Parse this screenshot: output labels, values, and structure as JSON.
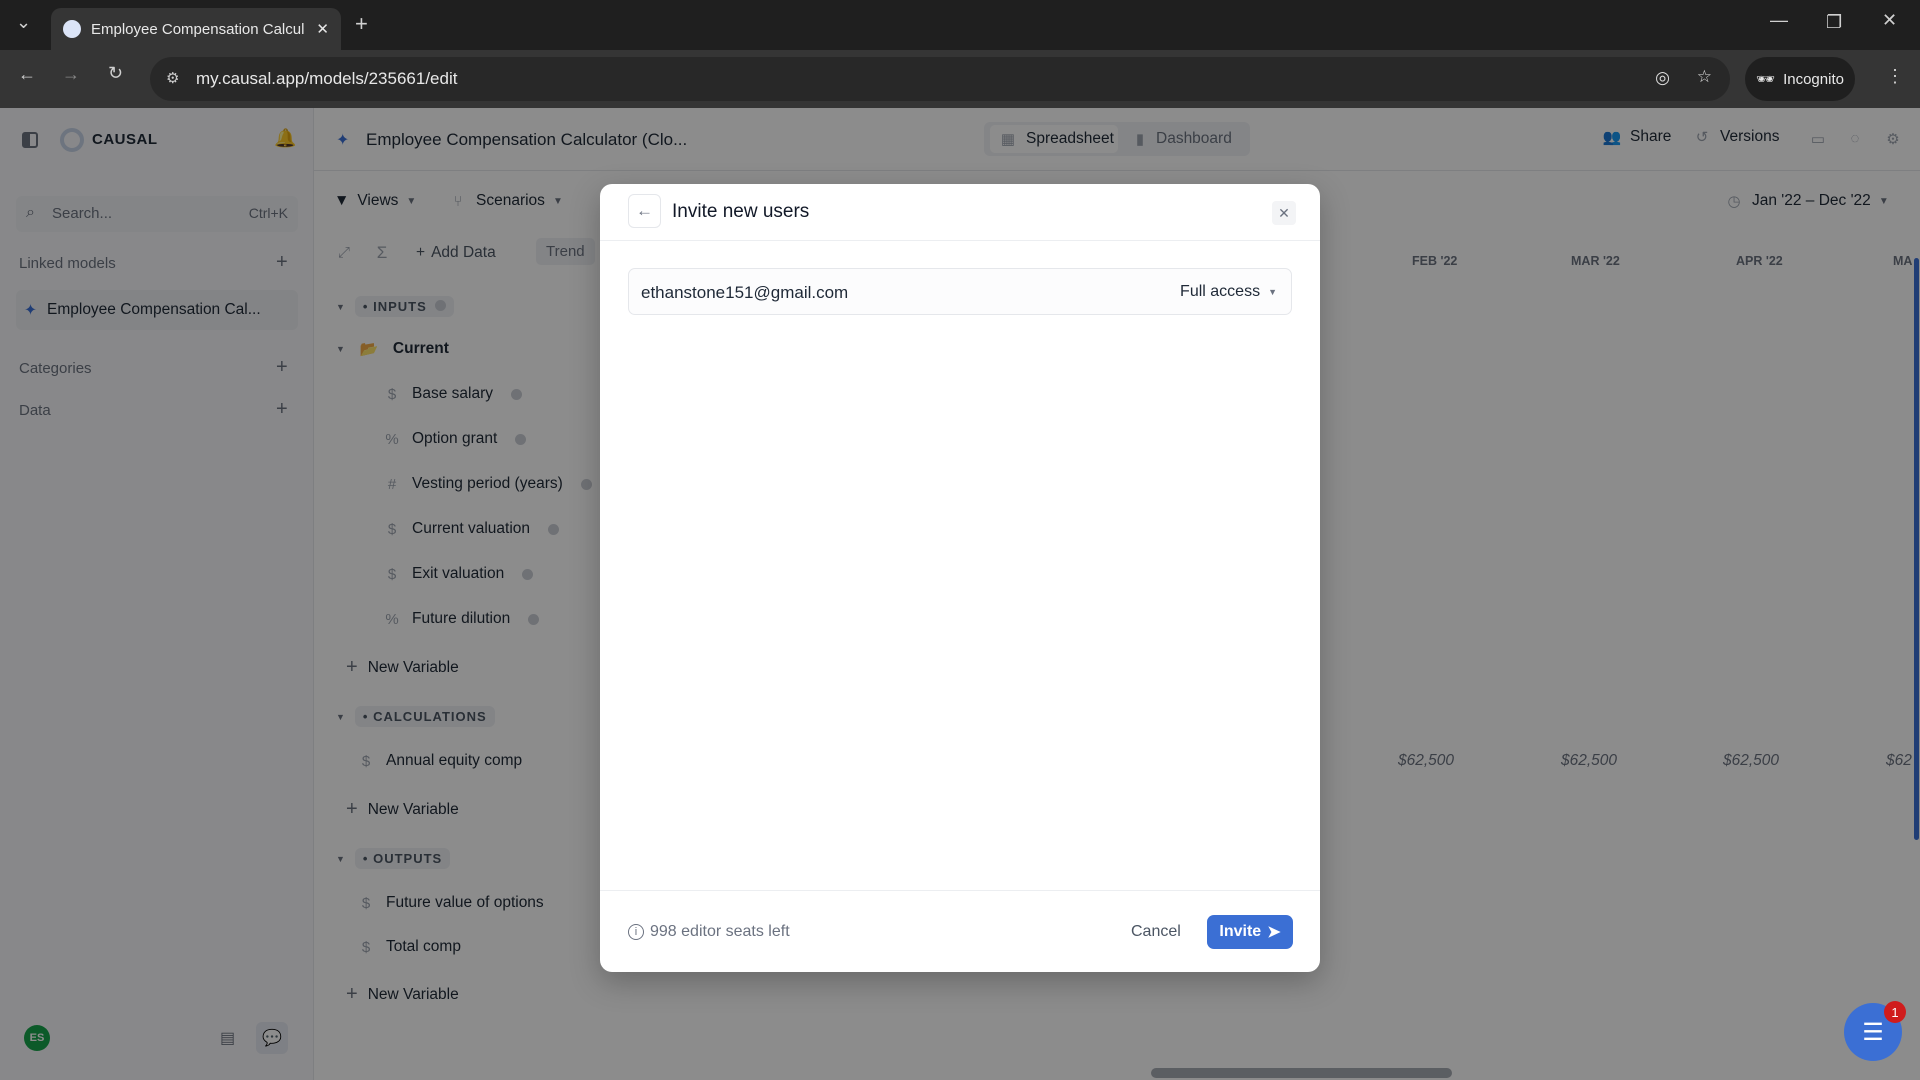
{
  "browser": {
    "tab_title": "Employee Compensation Calcul",
    "url": "my.causal.app/models/235661/edit",
    "incognito_label": "Incognito"
  },
  "sidebar": {
    "brand": "CAUSAL",
    "search_placeholder": "Search...",
    "search_shortcut": "Ctrl+K",
    "linked_models_label": "Linked models",
    "linked_model_item": "Employee Compensation Cal...",
    "categories_label": "Categories",
    "data_label": "Data",
    "avatar_initials": "ES"
  },
  "header": {
    "model_title": "Employee Compensation Calculator (Clo...",
    "tabs": [
      {
        "label": "Spreadsheet",
        "active": true
      },
      {
        "label": "Dashboard",
        "active": false
      }
    ],
    "share_label": "Share",
    "versions_label": "Versions"
  },
  "toolbar": {
    "views_label": "Views",
    "scenarios_label": "Scenarios",
    "add_data_label": "Add Data",
    "trend_label": "Trend",
    "date_range": "Jan '22 – Dec '22"
  },
  "grid": {
    "columns": [
      "FEB '22",
      "MAR '22",
      "APR '22",
      "MA"
    ],
    "sections": {
      "inputs": "INPUTS",
      "calculations": "CALCULATIONS",
      "outputs": "OUTPUTS"
    },
    "group": "Current",
    "inputs": [
      {
        "icon": "$",
        "label": "Base salary"
      },
      {
        "icon": "%",
        "label": "Option grant"
      },
      {
        "icon": "#",
        "label": "Vesting period (years)"
      },
      {
        "icon": "$",
        "label": "Current valuation"
      },
      {
        "icon": "$",
        "label": "Exit valuation"
      },
      {
        "icon": "%",
        "label": "Future dilution"
      }
    ],
    "calculations": [
      {
        "label": "Annual equity comp",
        "values": [
          "$62,500",
          "$62,500",
          "$62,500",
          "$62"
        ]
      }
    ],
    "outputs": [
      {
        "label": "Future value of options"
      },
      {
        "label": "Total comp"
      }
    ],
    "new_variable_label": "New Variable"
  },
  "modal": {
    "title": "Invite new users",
    "email_value": "ethanstone151@gmail.com",
    "access_level": "Full access",
    "seats_info": "998 editor seats left",
    "cancel_label": "Cancel",
    "invite_label": "Invite"
  },
  "chat": {
    "badge_count": "1"
  },
  "colors": {
    "accent": "#3b6fd4",
    "badge": "#d01c1c"
  }
}
